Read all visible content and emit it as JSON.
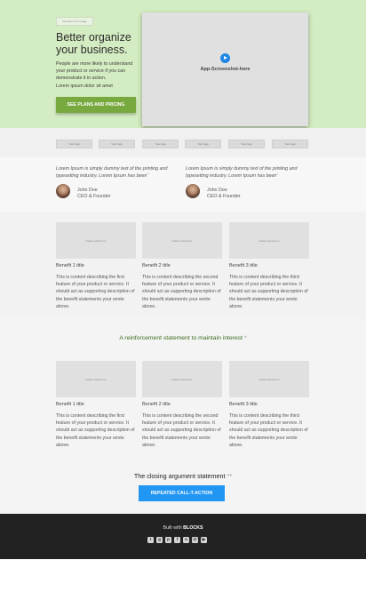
{
  "hero": {
    "badge": "The Best Icon Image",
    "title": "Better organize your business.",
    "text": "People are more likely to understand your product or service if you can demonstrate it in action.",
    "lorem": "Lorem ipsum dolor sit amet",
    "cta_label": "SEE PLANS AND PRICING",
    "screenshot_label": "App-Screenshot-here",
    "play_icon": "play-icon"
  },
  "logos": [
    "Your logo",
    "Your logo",
    "Your logo",
    "Your logo",
    "Your logo",
    "Your logo"
  ],
  "testimonials": [
    {
      "quote": "Lorem Ipsum is simply dummy text of the printing and typesetting industry. Lorem Ipsum has been'",
      "name": "John Doe",
      "role": "CEO & Founder"
    },
    {
      "quote": "Lorem Ipsum is simply dummy text of the printing and typesetting industry. Lorem Ipsum has been'",
      "name": "John Doe",
      "role": "CEO & Founder"
    }
  ],
  "benefits": [
    {
      "image_label": "feature-shot-here",
      "title": "Benefit 1 title",
      "text": "This is content describing the first feature of your product or service. It should act as supporting description of the benefit statements your wrote above."
    },
    {
      "image_label": "feature-shot-here",
      "title": "Benefit 2 title",
      "text": "This is content describing the second feature of your product or service. It should act as supporting description of the benefit statements your wrote above."
    },
    {
      "image_label": "feature-shot-here",
      "title": "Benefit 3 title",
      "text": "This is content describing the third feature of your product or service. It should act as supporting description of the benefit statements your wrote above."
    }
  ],
  "reinforcement": {
    "text": "A reinforcement statement to maintain interest",
    "mark": "*"
  },
  "features": [
    {
      "image_label": "feature-shot-here",
      "title": "Benefit 1 title",
      "text": "This is content describing the first feature of your product or service. It should act as supporting description of the benefit statements your wrote above."
    },
    {
      "image_label": "feature-shot-here",
      "title": "Benefit 2 title",
      "text": "This is content describing the second feature of your product or service. It should act as supporting description of the benefit statements your wrote above."
    },
    {
      "image_label": "feature-shot-here",
      "title": "Benefit 3 title",
      "text": "This is content describing the third feature of your product or service. It should act as supporting description of the benefit statements your wrote above."
    }
  ],
  "closing": {
    "title": "The closing argument statement",
    "mark": "**",
    "cta_label": "REPEATED CALL-T-ACTION"
  },
  "footer": {
    "built_prefix": "Built with",
    "built_brand": "BLOCKS",
    "social": [
      {
        "icon": "twitter-icon",
        "glyph": "t"
      },
      {
        "icon": "google-plus-icon",
        "glyph": "g"
      },
      {
        "icon": "pinterest-icon",
        "glyph": "p"
      },
      {
        "icon": "facebook-icon",
        "glyph": "f"
      },
      {
        "icon": "github-icon",
        "glyph": "o"
      },
      {
        "icon": "email-icon",
        "glyph": "@"
      },
      {
        "icon": "youtube-icon",
        "glyph": "▶"
      }
    ]
  },
  "colors": {
    "hero_bg": "#d4ecc2",
    "cta_green": "#78a93f",
    "cta_blue": "#2196f3",
    "reinforce_text": "#3b6c1e",
    "footer_bg": "#222222"
  }
}
